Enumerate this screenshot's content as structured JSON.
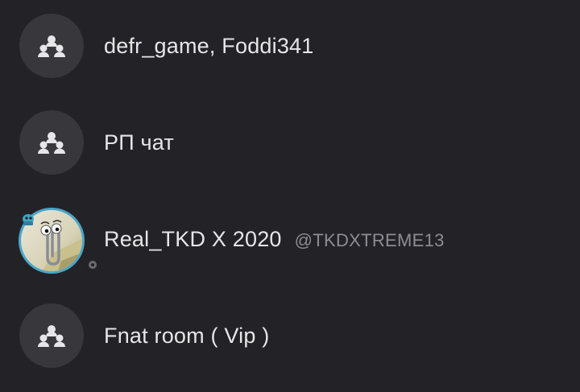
{
  "chats": [
    {
      "title": "defr_game, Foddi341",
      "type": "group",
      "icon": "group-icon"
    },
    {
      "title": "РП чат",
      "type": "group",
      "icon": "group-icon"
    },
    {
      "title": "Real_TKD X 2020",
      "handle": "@TKDXTREME13",
      "type": "direct",
      "status": "offline",
      "avatar": "paperclip-assistant-avatar"
    },
    {
      "title": "Fnat room ( Vip )",
      "type": "group",
      "icon": "group-icon"
    }
  ],
  "colors": {
    "background": "#232327",
    "avatar_bg": "#37373c",
    "title_text": "#e6e6e8",
    "handle_text": "#8c8c92",
    "status_offline": "#6b6b70"
  }
}
